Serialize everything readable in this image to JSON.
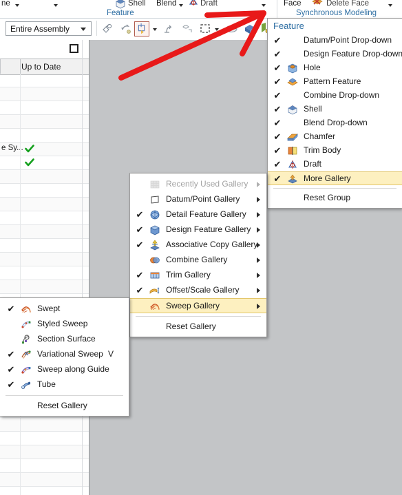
{
  "ribbon": {
    "items_row1": [
      {
        "label": "ne",
        "icon": "none"
      },
      {
        "label": "",
        "icon": "none"
      },
      {
        "label": "Shell",
        "icon": "shell-icon"
      },
      {
        "label": "Blend",
        "icon": "none"
      },
      {
        "label": "Draft",
        "icon": "draft-icon"
      },
      {
        "label": "Face",
        "icon": "none"
      },
      {
        "label": "Delete Face",
        "icon": "delete-face-icon"
      }
    ],
    "group_feature": "Feature",
    "group_synchronous": "Synchronous Modeling"
  },
  "toolbar": {
    "scope_value": "Entire Assembly",
    "scope_options": [
      "Entire Assembly"
    ]
  },
  "left_panel": {
    "column_header": "Up to Date",
    "rows": [
      {
        "name": "",
        "uptodate": false
      },
      {
        "name": "",
        "uptodate": false
      },
      {
        "name": "",
        "uptodate": false
      },
      {
        "name": "",
        "uptodate": false
      },
      {
        "name": "",
        "uptodate": false
      },
      {
        "name": "e Sy...",
        "uptodate": true
      },
      {
        "name": "",
        "uptodate": true
      },
      {
        "name": "",
        "uptodate": false
      },
      {
        "name": "",
        "uptodate": false
      },
      {
        "name": "",
        "uptodate": false
      },
      {
        "name": "",
        "uptodate": false
      },
      {
        "name": "",
        "uptodate": false
      },
      {
        "name": "",
        "uptodate": false
      },
      {
        "name": "",
        "uptodate": false
      },
      {
        "name": "",
        "uptodate": false
      },
      {
        "name": "",
        "uptodate": false
      },
      {
        "name": "",
        "uptodate": false
      },
      {
        "name": "",
        "uptodate": false
      },
      {
        "name": "",
        "uptodate": false
      },
      {
        "name": "",
        "uptodate": false
      },
      {
        "name": "",
        "uptodate": false
      },
      {
        "name": "",
        "uptodate": false
      },
      {
        "name": "",
        "uptodate": false
      },
      {
        "name": "",
        "uptodate": false
      },
      {
        "name": "",
        "uptodate": false
      },
      {
        "name": "",
        "uptodate": false
      },
      {
        "name": "",
        "uptodate": false
      },
      {
        "name": "",
        "uptodate": false
      },
      {
        "name": "",
        "uptodate": false
      },
      {
        "name": "",
        "uptodate": false
      },
      {
        "name": "",
        "uptodate": false
      }
    ]
  },
  "feature_panel": {
    "title": "Feature",
    "items": [
      {
        "label": "Datum/Point Drop-down",
        "checked": true,
        "icon": "none",
        "highlighted": false
      },
      {
        "label": "Design Feature Drop-down",
        "checked": true,
        "icon": "none",
        "highlighted": false
      },
      {
        "label": "Hole",
        "checked": true,
        "icon": "hole-icon",
        "highlighted": false
      },
      {
        "label": "Pattern Feature",
        "checked": true,
        "icon": "pattern-feature-icon",
        "highlighted": false
      },
      {
        "label": "Combine Drop-down",
        "checked": true,
        "icon": "none",
        "highlighted": false
      },
      {
        "label": "Shell",
        "checked": true,
        "icon": "shell-icon",
        "highlighted": false
      },
      {
        "label": "Blend Drop-down",
        "checked": true,
        "icon": "none",
        "highlighted": false
      },
      {
        "label": "Chamfer",
        "checked": true,
        "icon": "chamfer-icon",
        "highlighted": false
      },
      {
        "label": "Trim Body",
        "checked": true,
        "icon": "trim-body-icon",
        "highlighted": false
      },
      {
        "label": "Draft",
        "checked": true,
        "icon": "draft-icon",
        "highlighted": false
      },
      {
        "label": "More Gallery",
        "checked": true,
        "icon": "more-gallery-icon",
        "highlighted": true
      }
    ],
    "reset_label": "Reset Group"
  },
  "gallery_menu": {
    "items": [
      {
        "label": "Recently Used Gallery",
        "checked": false,
        "disabled": true,
        "icon": "recently-used-icon",
        "submenu": true,
        "highlighted": false
      },
      {
        "label": "Datum/Point Gallery",
        "checked": false,
        "disabled": false,
        "icon": "datum-point-icon",
        "submenu": true,
        "highlighted": false
      },
      {
        "label": "Detail Feature Gallery",
        "checked": true,
        "disabled": false,
        "icon": "detail-feature-icon",
        "submenu": true,
        "highlighted": false
      },
      {
        "label": "Design Feature Gallery",
        "checked": true,
        "disabled": false,
        "icon": "design-feature-icon",
        "submenu": true,
        "highlighted": false
      },
      {
        "label": "Associative Copy Gallery",
        "checked": true,
        "disabled": false,
        "icon": "associative-copy-icon",
        "submenu": true,
        "highlighted": false
      },
      {
        "label": "Combine Gallery",
        "checked": false,
        "disabled": false,
        "icon": "combine-icon",
        "submenu": true,
        "highlighted": false
      },
      {
        "label": "Trim Gallery",
        "checked": true,
        "disabled": false,
        "icon": "trim-icon",
        "submenu": true,
        "highlighted": false
      },
      {
        "label": "Offset/Scale Gallery",
        "checked": true,
        "disabled": false,
        "icon": "offset-scale-icon",
        "submenu": true,
        "highlighted": false
      },
      {
        "label": "Sweep Gallery",
        "checked": false,
        "disabled": false,
        "icon": "sweep-icon",
        "submenu": true,
        "highlighted": true
      }
    ],
    "reset_label": "Reset Gallery"
  },
  "sweep_menu": {
    "items": [
      {
        "label": "Swept",
        "checked": true,
        "icon": "swept-icon",
        "shortcut": ""
      },
      {
        "label": "Styled Sweep",
        "checked": false,
        "icon": "styled-sweep-icon",
        "shortcut": ""
      },
      {
        "label": "Section Surface",
        "checked": false,
        "icon": "section-surface-icon",
        "shortcut": ""
      },
      {
        "label": "Variational Sweep",
        "checked": true,
        "icon": "variational-sweep-icon",
        "shortcut": "V"
      },
      {
        "label": "Sweep along Guide",
        "checked": true,
        "icon": "sweep-along-guide-icon",
        "shortcut": ""
      },
      {
        "label": "Tube",
        "checked": true,
        "icon": "tube-icon",
        "shortcut": ""
      }
    ],
    "reset_label": "Reset Gallery"
  },
  "annotation": {
    "color": "#e81919",
    "type": "arrow",
    "description": "red arrow pointing to ribbon group dropdown"
  },
  "glyphs": {
    "check": "✔",
    "checkmark_green": "✔"
  }
}
